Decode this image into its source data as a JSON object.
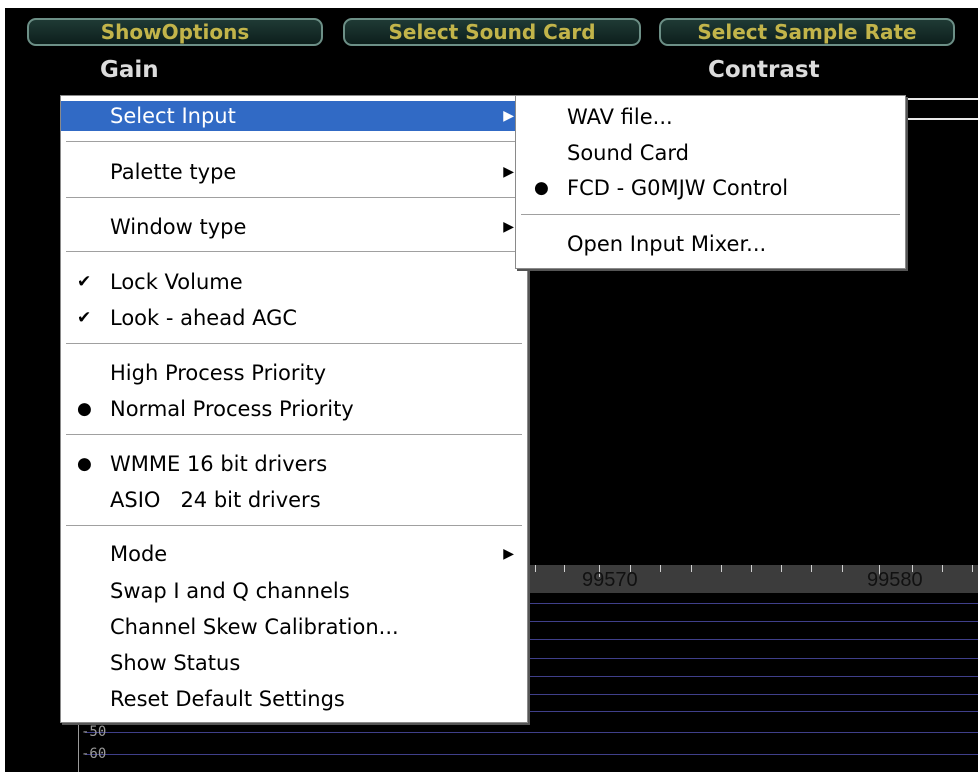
{
  "toolbar": {
    "show_options": "ShowOptions",
    "select_sound_card": "Select Sound Card",
    "select_sample_rate": "Select Sample Rate"
  },
  "labels": {
    "gain": "Gain",
    "contrast": "Contrast"
  },
  "ruler": {
    "labels": [
      "99570",
      "99580"
    ]
  },
  "scale": {
    "labels": [
      "-50",
      "-60"
    ]
  },
  "menu": {
    "items": [
      {
        "label": "Select Input",
        "submenu": true,
        "highlighted": true
      },
      {
        "label": "Palette type",
        "submenu": true
      },
      {
        "label": "Window type",
        "submenu": true
      },
      {
        "label": "Lock Volume",
        "checked": true
      },
      {
        "label": "Look - ahead AGC",
        "checked": true
      },
      {
        "label": "High Process Priority"
      },
      {
        "label": "Normal Process Priority",
        "selected": true
      },
      {
        "label": "WMME 16 bit drivers",
        "selected": true
      },
      {
        "label": "ASIO   24 bit drivers"
      },
      {
        "label": "Mode",
        "submenu": true
      },
      {
        "label": "Swap I and Q channels"
      },
      {
        "label": "Channel Skew Calibration..."
      },
      {
        "label": "Show Status"
      },
      {
        "label": "Reset Default Settings"
      }
    ]
  },
  "submenu": {
    "items": [
      {
        "label": "WAV file..."
      },
      {
        "label": "Sound Card"
      },
      {
        "label": "FCD - G0MJW Control",
        "selected": true
      },
      {
        "label": "Open Input Mixer..."
      }
    ]
  },
  "glyphs": {
    "check": "✔",
    "bullet": "●",
    "arrow": "▶"
  },
  "colors": {
    "menu_highlight": "#316ac5",
    "button_text": "#c2b44a",
    "grid": "#3f3f8a"
  }
}
